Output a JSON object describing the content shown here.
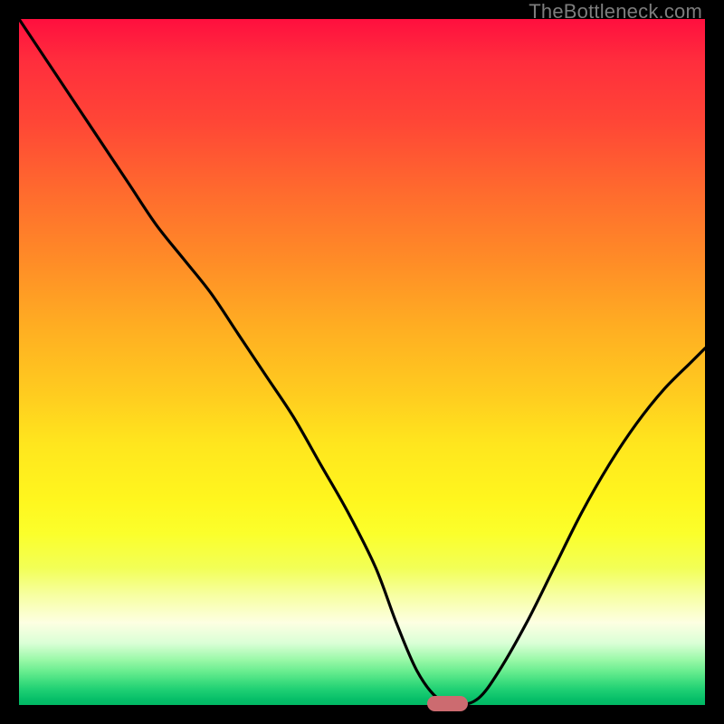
{
  "watermark": "TheBottleneck.com",
  "colors": {
    "frame": "#000000",
    "curve": "#000000",
    "marker": "#cc6b70"
  },
  "chart_data": {
    "type": "line",
    "title": "",
    "xlabel": "",
    "ylabel": "",
    "xlim": [
      0,
      100
    ],
    "ylim": [
      0,
      100
    ],
    "grid": false,
    "legend": false,
    "series": [
      {
        "name": "bottleneck-curve",
        "x": [
          0,
          4,
          8,
          12,
          16,
          20,
          24,
          28,
          32,
          36,
          40,
          44,
          48,
          52,
          55,
          58,
          61,
          64,
          67,
          70,
          74,
          78,
          82,
          86,
          90,
          94,
          98,
          100
        ],
        "y": [
          100,
          94,
          88,
          82,
          76,
          70,
          65,
          60,
          54,
          48,
          42,
          35,
          28,
          20,
          12,
          5,
          1,
          0,
          1,
          5,
          12,
          20,
          28,
          35,
          41,
          46,
          50,
          52
        ]
      }
    ],
    "marker": {
      "x_pct": 62.5,
      "width_pct": 6.0,
      "y_pct": 0.0
    },
    "background_gradient": "red-yellow-green vertical"
  }
}
